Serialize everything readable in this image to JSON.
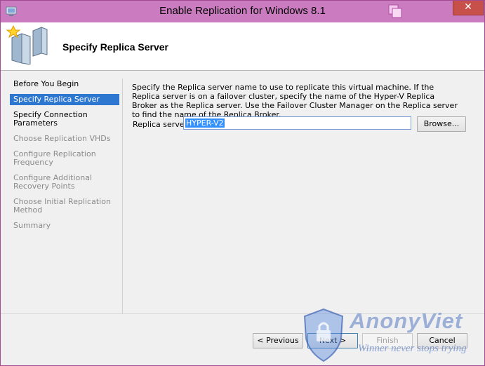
{
  "window": {
    "title": "Enable Replication for Windows 8.1",
    "close_label": "✕"
  },
  "header": {
    "title": "Specify Replica Server"
  },
  "nav": {
    "items": [
      {
        "label": "Before You Begin",
        "state": "done"
      },
      {
        "label": "Specify Replica Server",
        "state": "active"
      },
      {
        "label": "Specify Connection Parameters",
        "state": "done"
      },
      {
        "label": "Choose Replication VHDs",
        "state": "pending"
      },
      {
        "label": "Configure Replication Frequency",
        "state": "pending"
      },
      {
        "label": "Configure Additional Recovery Points",
        "state": "pending"
      },
      {
        "label": "Choose Initial Replication Method",
        "state": "pending"
      },
      {
        "label": "Summary",
        "state": "pending"
      }
    ]
  },
  "main": {
    "description": "Specify the Replica server name to use to replicate this virtual machine. If the Replica server is on a failover cluster, specify the name of the Hyper-V Replica Broker as the Replica server. Use the Failover Cluster Manager on the Replica server to find the name of the Replica Broker.",
    "replica_label": "Replica server:",
    "replica_value": "HYPER-V2",
    "browse_label": "Browse..."
  },
  "footer": {
    "previous_label": "< Previous",
    "next_label": "Next >",
    "finish_label": "Finish",
    "cancel_label": "Cancel"
  },
  "watermark": {
    "name": "AnonyViet",
    "slogan": "Winner never stops trying"
  },
  "colors": {
    "titlebar": "#cb7cc0",
    "active_nav": "#2e77d0",
    "close": "#c7504a"
  }
}
